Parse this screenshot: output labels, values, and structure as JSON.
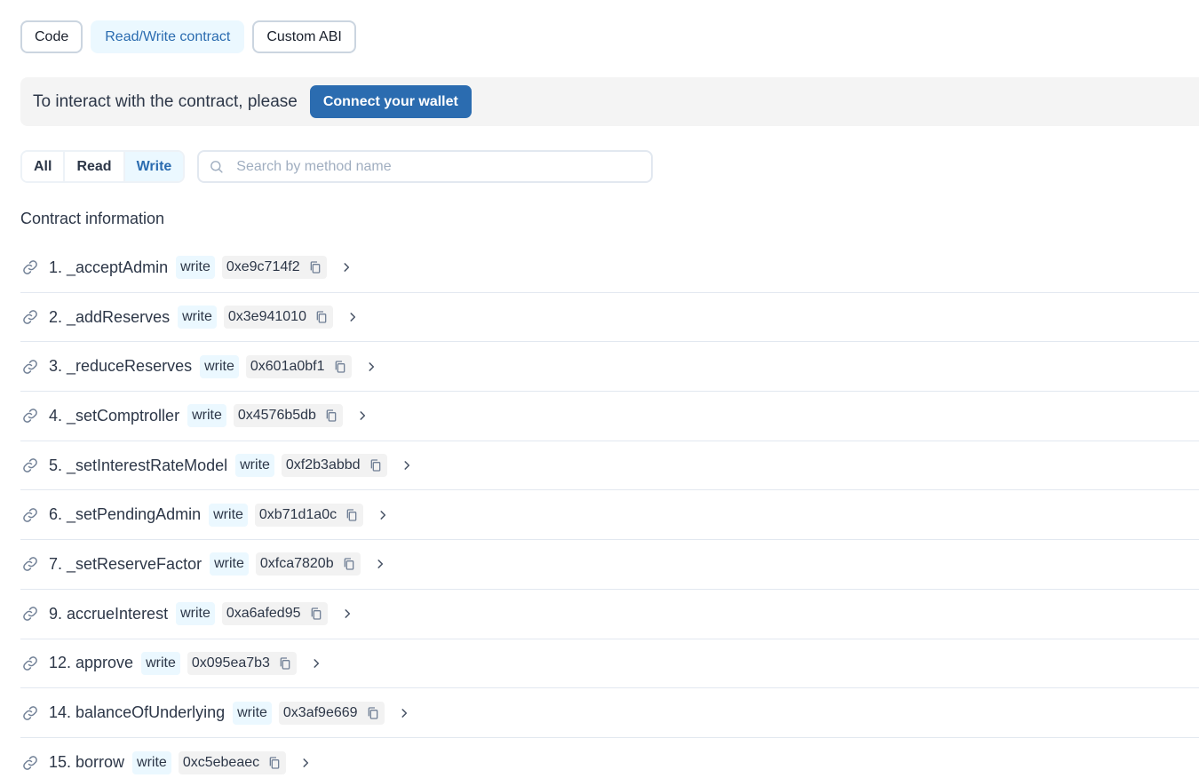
{
  "top_tabs": [
    {
      "label": "Code",
      "active": false
    },
    {
      "label": "Read/Write contract",
      "active": true
    },
    {
      "label": "Custom ABI",
      "active": false
    }
  ],
  "wallet_banner": {
    "text": "To interact with the contract, please",
    "button_label": "Connect your wallet"
  },
  "filter": {
    "options": [
      {
        "label": "All",
        "active": false
      },
      {
        "label": "Read",
        "active": false
      },
      {
        "label": "Write",
        "active": true
      }
    ],
    "search_placeholder": "Search by method name",
    "search_value": ""
  },
  "section_title": "Contract information",
  "methods": [
    {
      "name": "1. _acceptAdmin",
      "tag": "write",
      "selector": "0xe9c714f2"
    },
    {
      "name": "2. _addReserves",
      "tag": "write",
      "selector": "0x3e941010"
    },
    {
      "name": "3. _reduceReserves",
      "tag": "write",
      "selector": "0x601a0bf1"
    },
    {
      "name": "4. _setComptroller",
      "tag": "write",
      "selector": "0x4576b5db"
    },
    {
      "name": "5. _setInterestRateModel",
      "tag": "write",
      "selector": "0xf2b3abbd"
    },
    {
      "name": "6. _setPendingAdmin",
      "tag": "write",
      "selector": "0xb71d1a0c"
    },
    {
      "name": "7. _setReserveFactor",
      "tag": "write",
      "selector": "0xfca7820b"
    },
    {
      "name": "9. accrueInterest",
      "tag": "write",
      "selector": "0xa6afed95"
    },
    {
      "name": "12. approve",
      "tag": "write",
      "selector": "0x095ea7b3"
    },
    {
      "name": "14. balanceOfUnderlying",
      "tag": "write",
      "selector": "0x3af9e669"
    },
    {
      "name": "15. borrow",
      "tag": "write",
      "selector": "0xc5ebeaec"
    }
  ],
  "colors": {
    "accent": "#2b6cb0",
    "accent_light": "#ebf8ff",
    "banner_bg": "#f4f4f4",
    "icon_gray": "#718096"
  },
  "icons": {
    "method_link": "link-icon",
    "copy": "copy-icon",
    "expand": "chevron-right-icon",
    "search": "search-icon"
  }
}
